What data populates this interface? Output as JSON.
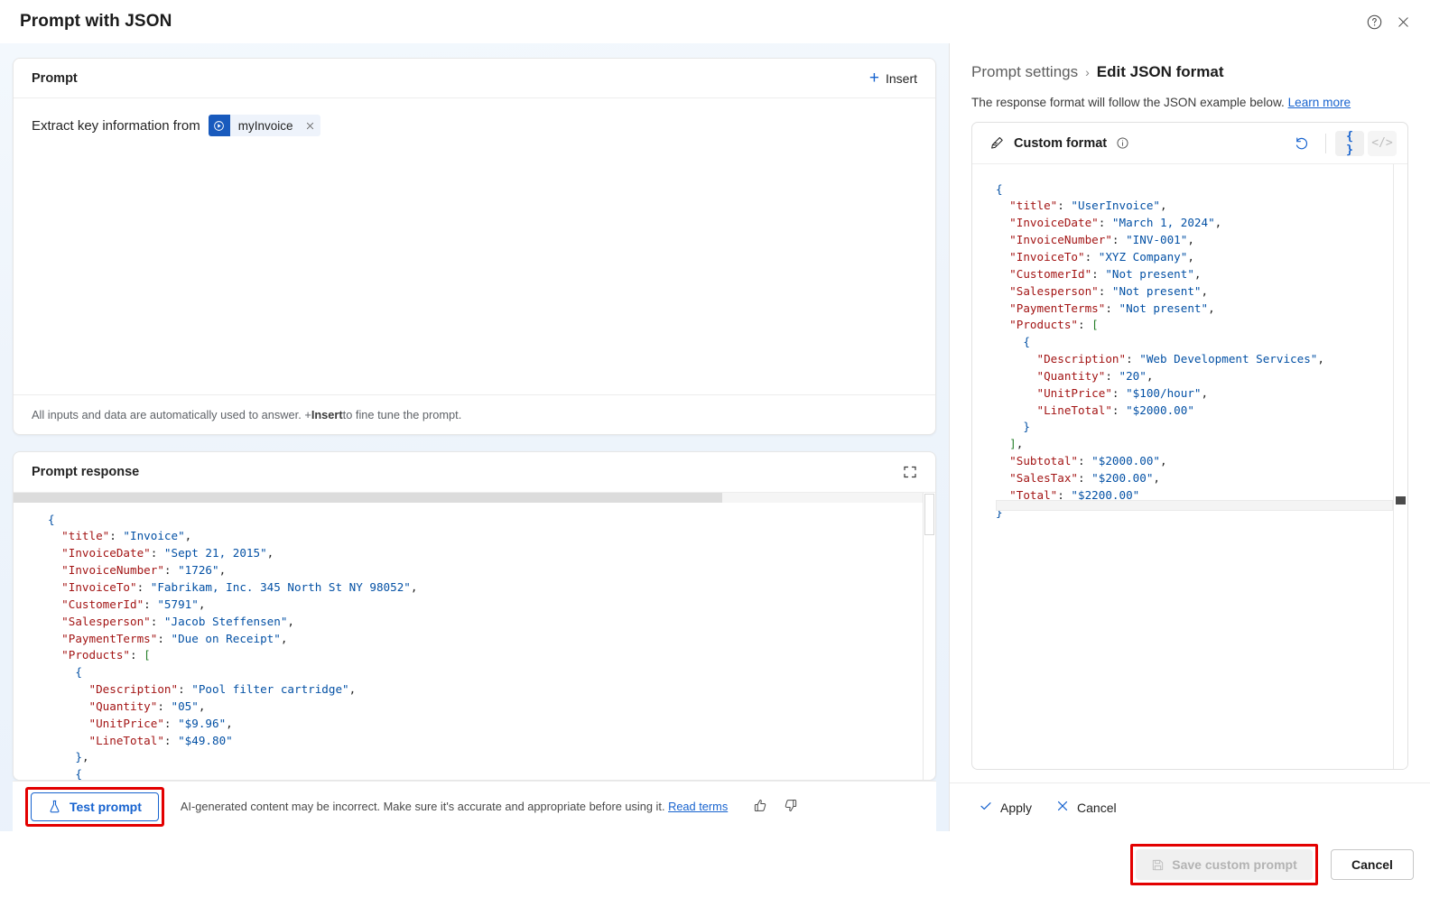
{
  "window": {
    "title": "Prompt with JSON",
    "help_icon": "help-icon",
    "close_icon": "close-icon"
  },
  "left": {
    "prompt_card": {
      "header": "Prompt",
      "insert_label": "Insert",
      "lead_text": "Extract key information from",
      "pill_label": "myInvoice",
      "footer_prefix": "All inputs and data are automatically used to answer. + ",
      "footer_bold": "Insert",
      "footer_suffix": " to fine tune the prompt."
    },
    "response_card": {
      "header": "Prompt response",
      "expand_icon": "expand-icon",
      "code": "{\n  \"title\": \"Invoice\",\n  \"InvoiceDate\": \"Sept 21, 2015\",\n  \"InvoiceNumber\": \"1726\",\n  \"InvoiceTo\": \"Fabrikam, Inc. 345 North St NY 98052\",\n  \"CustomerId\": \"5791\",\n  \"Salesperson\": \"Jacob Steffensen\",\n  \"PaymentTerms\": \"Due on Receipt\",\n  \"Products\": [\n    {\n      \"Description\": \"Pool filter cartridge\",\n      \"Quantity\": \"05\",\n      \"UnitPrice\": \"$9.96\",\n      \"LineTotal\": \"$49.80\"\n    },\n    {"
    },
    "footer": {
      "test_prompt_label": "Test prompt",
      "disclaimer": "AI-generated content may be incorrect. Make sure it's accurate and appropriate before using it.",
      "read_terms_label": "Read terms",
      "thumbs_up_icon": "thumbs-up-icon",
      "thumbs_down_icon": "thumbs-down-icon"
    }
  },
  "right": {
    "breadcrumb_parent": "Prompt settings",
    "breadcrumb_separator": "›",
    "breadcrumb_current": "Edit JSON format",
    "description": "The response format will follow the JSON example below.",
    "learn_more_label": "Learn more",
    "panel": {
      "title": "Custom format",
      "edit_icon": "edit-pen-icon",
      "info_icon": "info-icon",
      "reset_icon": "reset-icon",
      "json_view_label": "{ }",
      "code_view_label": "</>",
      "code": "{\n  \"title\": \"UserInvoice\",\n  \"InvoiceDate\": \"March 1, 2024\",\n  \"InvoiceNumber\": \"INV-001\",\n  \"InvoiceTo\": \"XYZ Company\",\n  \"CustomerId\": \"Not present\",\n  \"Salesperson\": \"Not present\",\n  \"PaymentTerms\": \"Not present\",\n  \"Products\": [\n    {\n      \"Description\": \"Web Development Services\",\n      \"Quantity\": \"20\",\n      \"UnitPrice\": \"$100/hour\",\n      \"LineTotal\": \"$2000.00\"\n    }\n  ],\n  \"Subtotal\": \"$2000.00\",\n  \"SalesTax\": \"$200.00\",\n  \"Total\": \"$2200.00\"\n}"
    },
    "actions": {
      "apply_label": "Apply",
      "cancel_label": "Cancel"
    }
  },
  "bottom": {
    "save_label": "Save custom prompt",
    "cancel_label": "Cancel",
    "save_icon": "save-disk-icon"
  },
  "colors": {
    "accent": "#1763cf",
    "highlight_outline": "#e30000",
    "json_key": "#a31515",
    "json_string": "#0451a5",
    "pill_icon_bg": "#185abd"
  }
}
